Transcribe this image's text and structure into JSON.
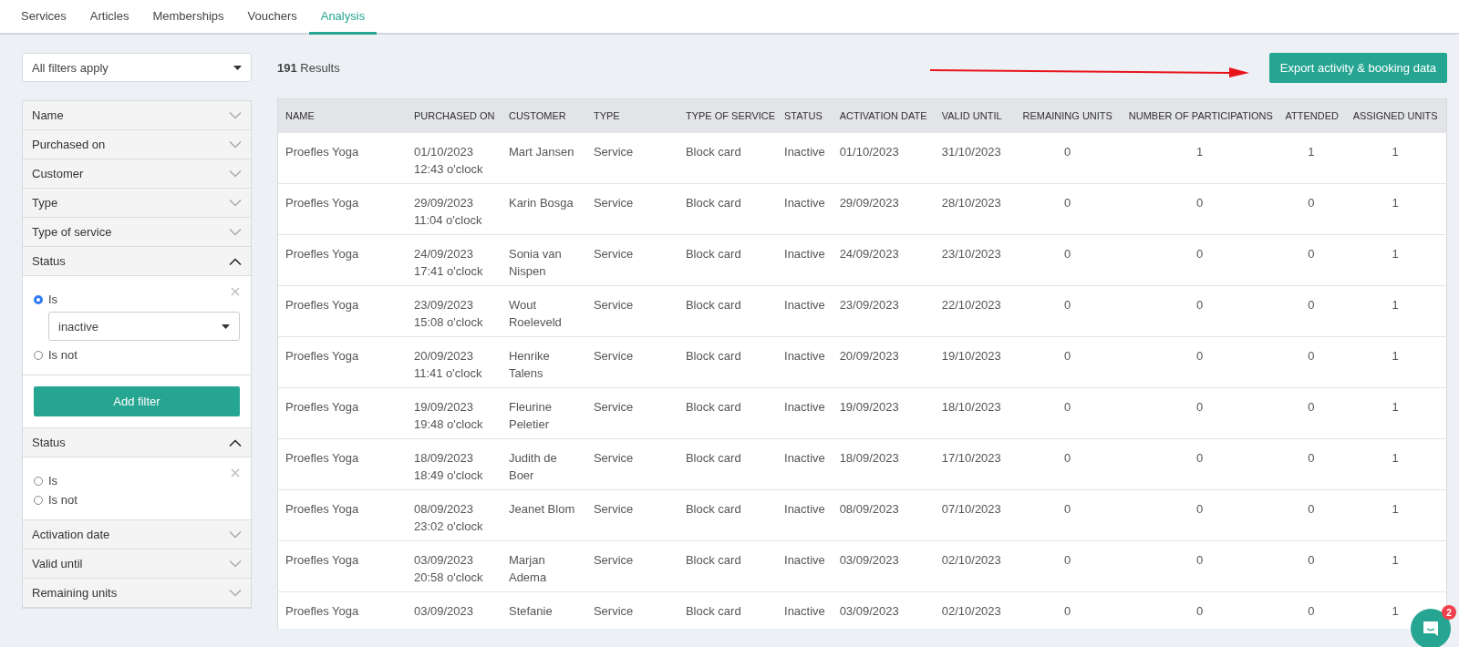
{
  "tabs": [
    {
      "label": "Services",
      "selected": false
    },
    {
      "label": "Articles",
      "selected": false
    },
    {
      "label": "Memberships",
      "selected": false
    },
    {
      "label": "Vouchers",
      "selected": false
    },
    {
      "label": "Analysis",
      "selected": true
    }
  ],
  "filter_mode": {
    "value": "All filters apply"
  },
  "results": {
    "text": "**191** Results"
  },
  "export_button": {
    "label": "Export activity & booking data"
  },
  "filters": [
    {
      "label": "Name",
      "expanded": false
    },
    {
      "label": "Purchased on",
      "expanded": false
    },
    {
      "label": "Customer",
      "expanded": false
    },
    {
      "label": "Type",
      "expanded": false
    },
    {
      "label": "Type of service",
      "expanded": false
    },
    {
      "label": "Status",
      "expanded": true,
      "options": [
        {
          "label": "Is",
          "selected": true,
          "select_value": "inactive"
        },
        {
          "label": "Is not",
          "selected": false
        }
      ],
      "button": "Add filter"
    },
    {
      "label": "Status",
      "expanded": true,
      "options": [
        {
          "label": "Is",
          "selected": false
        },
        {
          "label": "Is not",
          "selected": false
        }
      ]
    },
    {
      "label": "Activation date",
      "expanded": false
    },
    {
      "label": "Valid until",
      "expanded": false
    },
    {
      "label": "Remaining units",
      "expanded": false
    }
  ],
  "table": {
    "columns": [
      "NAME",
      "PURCHASED ON",
      "CUSTOMER",
      "TYPE",
      "TYPE OF SERVICE",
      "STATUS",
      "ACTIVATION DATE",
      "VALID UNTIL",
      "REMAINING UNITS",
      "NUMBER OF PARTICIPATIONS",
      "ATTENDED",
      "ASSIGNED UNITS"
    ],
    "rows": [
      [
        "Proefles Yoga",
        "01/10/2023\n12:43 o'clock",
        "Mart Jansen",
        "Service",
        "Block card",
        "Inactive",
        "01/10/2023",
        "31/10/2023",
        "0",
        "1",
        "1",
        "1"
      ],
      [
        "Proefles Yoga",
        "29/09/2023\n11:04 o'clock",
        "Karin Bosga",
        "Service",
        "Block card",
        "Inactive",
        "29/09/2023",
        "28/10/2023",
        "0",
        "0",
        "0",
        "1"
      ],
      [
        "Proefles Yoga",
        "24/09/2023\n17:41 o'clock",
        "Sonia van\nNispen",
        "Service",
        "Block card",
        "Inactive",
        "24/09/2023",
        "23/10/2023",
        "0",
        "0",
        "0",
        "1"
      ],
      [
        "Proefles Yoga",
        "23/09/2023\n15:08 o'clock",
        "Wout\nRoeleveld",
        "Service",
        "Block card",
        "Inactive",
        "23/09/2023",
        "22/10/2023",
        "0",
        "0",
        "0",
        "1"
      ],
      [
        "Proefles Yoga",
        "20/09/2023\n11:41 o'clock",
        "Henrike\nTalens",
        "Service",
        "Block card",
        "Inactive",
        "20/09/2023",
        "19/10/2023",
        "0",
        "0",
        "0",
        "1"
      ],
      [
        "Proefles Yoga",
        "19/09/2023\n19:48 o'clock",
        "Fleurine\nPeletier",
        "Service",
        "Block card",
        "Inactive",
        "19/09/2023",
        "18/10/2023",
        "0",
        "0",
        "0",
        "1"
      ],
      [
        "Proefles Yoga",
        "18/09/2023\n18:49 o'clock",
        "Judith de\nBoer",
        "Service",
        "Block card",
        "Inactive",
        "18/09/2023",
        "17/10/2023",
        "0",
        "0",
        "0",
        "1"
      ],
      [
        "Proefles Yoga",
        "08/09/2023\n23:02 o'clock",
        "Jeanet Blom",
        "Service",
        "Block card",
        "Inactive",
        "08/09/2023",
        "07/10/2023",
        "0",
        "0",
        "0",
        "1"
      ],
      [
        "Proefles Yoga",
        "03/09/2023\n20:58 o'clock",
        "Marjan\nAdema",
        "Service",
        "Block card",
        "Inactive",
        "03/09/2023",
        "02/10/2023",
        "0",
        "0",
        "0",
        "1"
      ],
      [
        "Proefles Yoga",
        "03/09/2023",
        "Stefanie",
        "Service",
        "Block card",
        "Inactive",
        "03/09/2023",
        "02/10/2023",
        "0",
        "0",
        "0",
        "1"
      ]
    ]
  },
  "chat_widget": {
    "badge": "2"
  }
}
